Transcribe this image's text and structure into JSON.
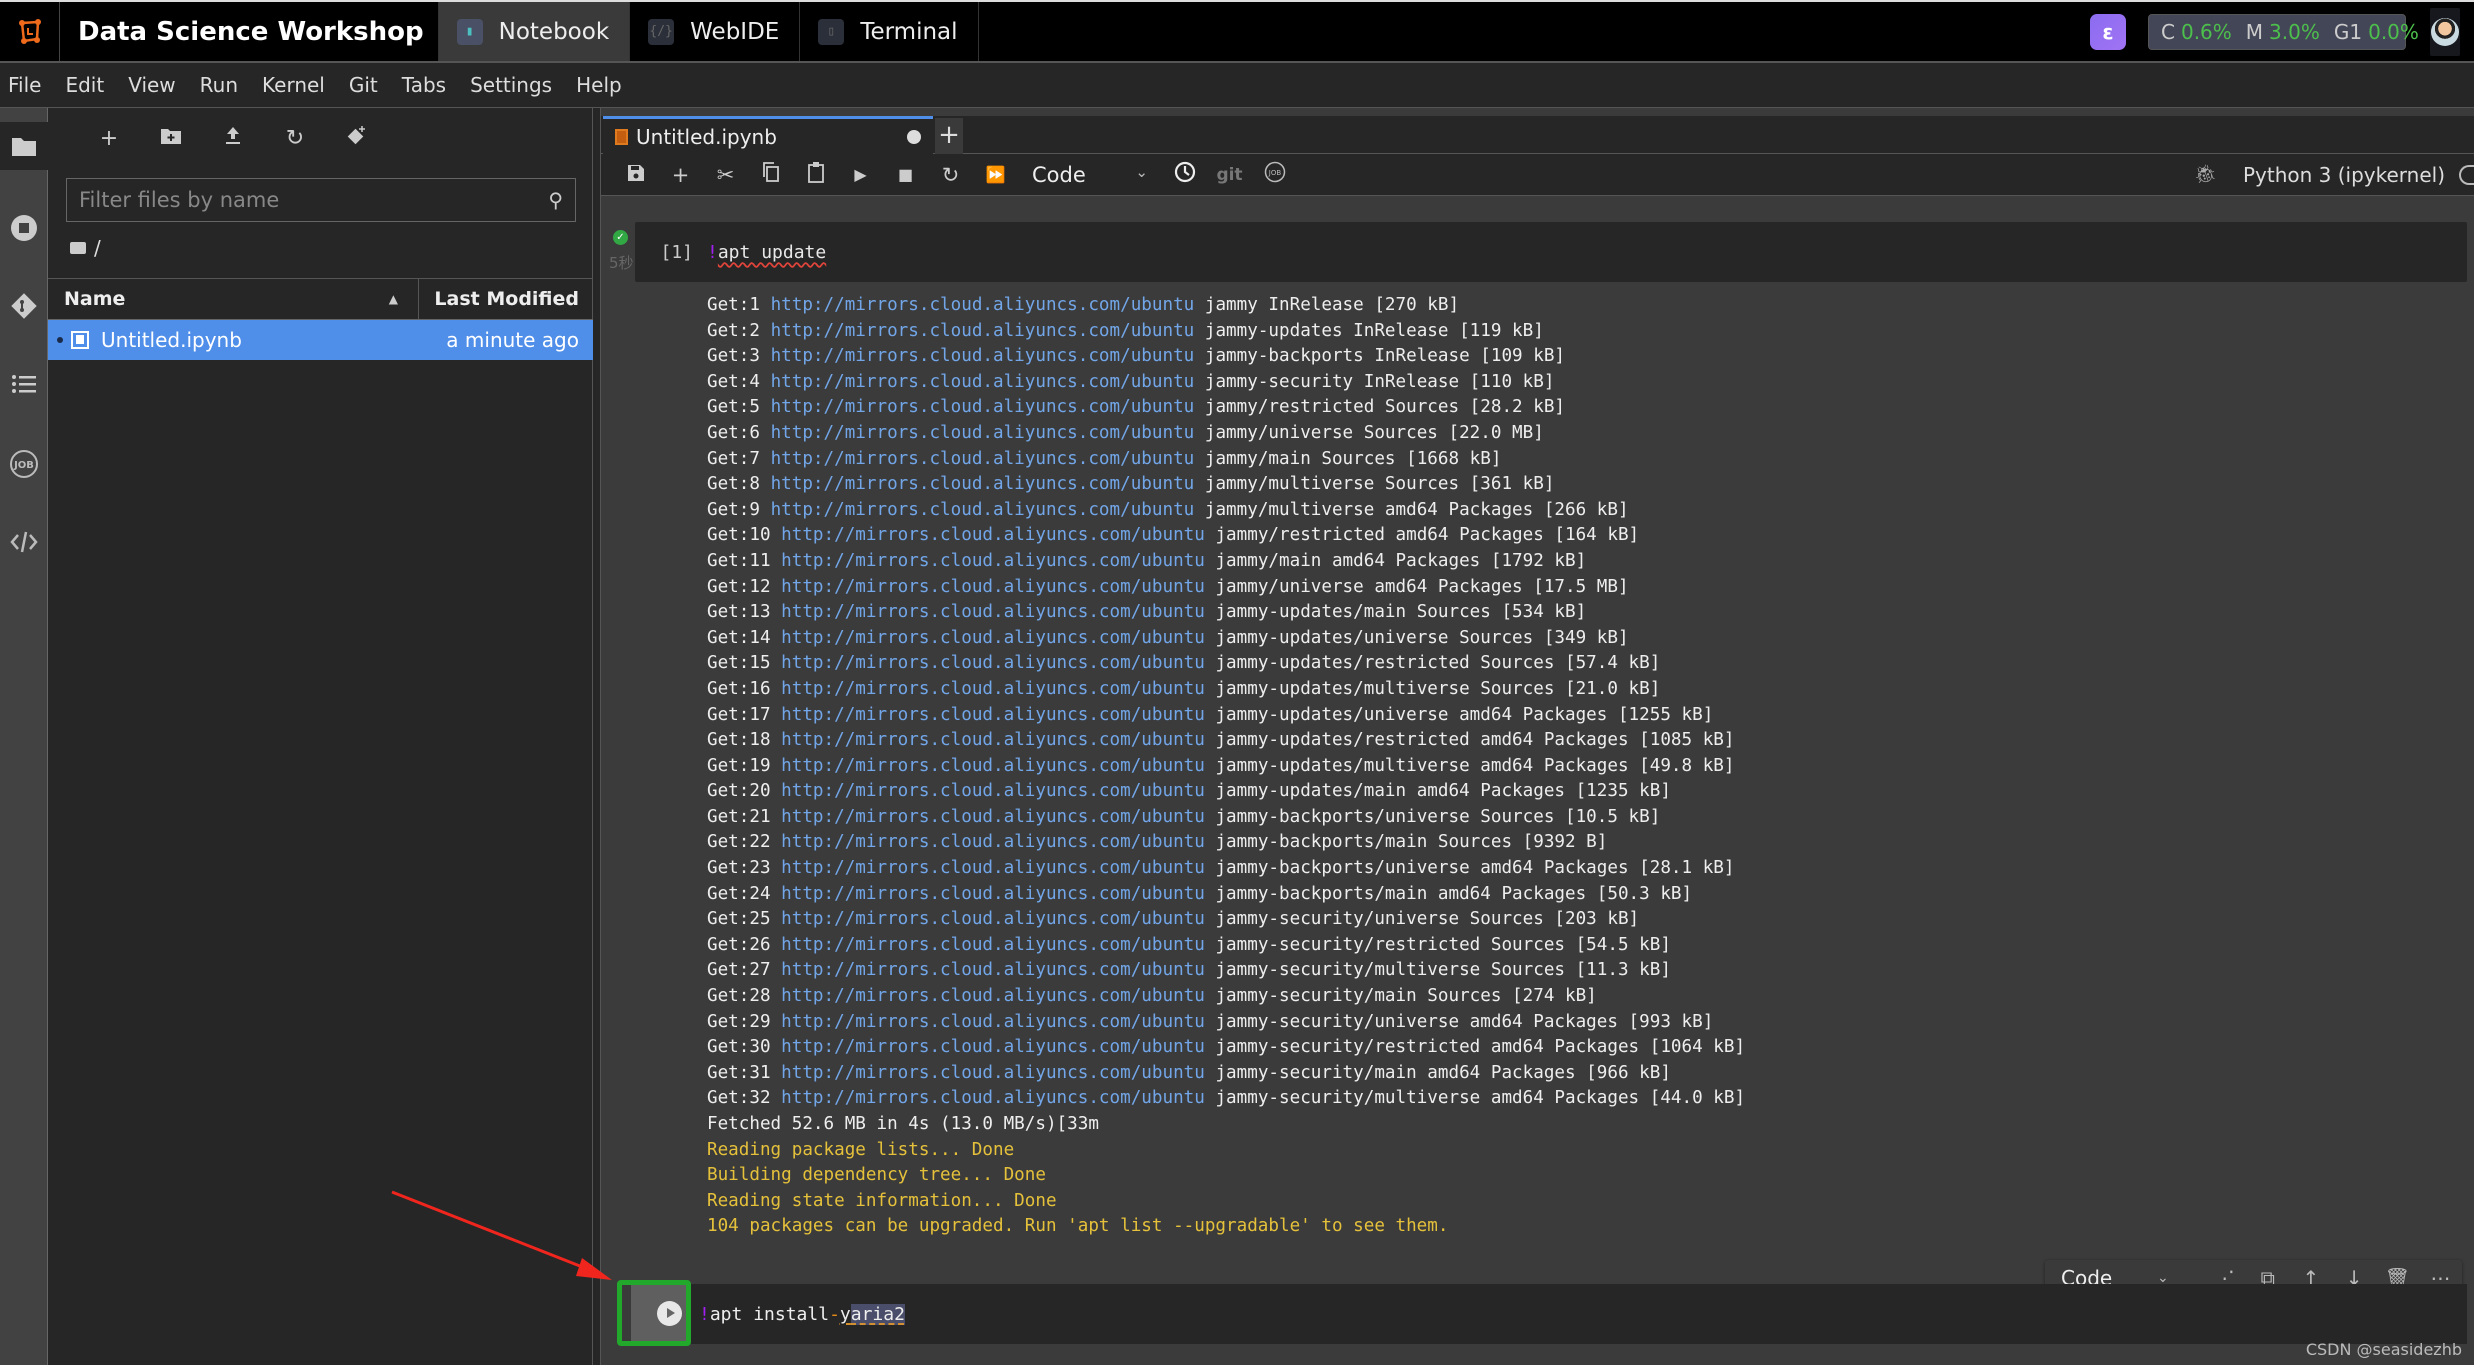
{
  "topbar": {
    "brand": "Data Science Workshop",
    "tabs": [
      {
        "label": "Notebook",
        "icon": "notebook-icon",
        "active": true
      },
      {
        "label": "WebIDE",
        "icon": "code-icon",
        "active": false
      },
      {
        "label": "Terminal",
        "icon": "terminal-icon",
        "active": false
      }
    ],
    "metrics": {
      "cpu_label": "C",
      "cpu": "0.6%",
      "mem_label": "M",
      "mem": "3.0%",
      "gpu_label": "G1",
      "gpu": "0.0%"
    }
  },
  "menu": [
    "File",
    "Edit",
    "View",
    "Run",
    "Kernel",
    "Git",
    "Tabs",
    "Settings",
    "Help"
  ],
  "filebrowser": {
    "search_placeholder": "Filter files by name",
    "breadcrumb": "/",
    "col_name": "Name",
    "col_modified": "Last Modified",
    "files": [
      {
        "name": "Untitled.ipynb",
        "modified": "a minute ago"
      }
    ]
  },
  "notebook": {
    "tab_title": "Untitled.ipynb",
    "cell_type": "Code",
    "git_label": "git",
    "kernel": "Python 3 (ipykernel)",
    "cell1": {
      "prompt": "[1]",
      "bang": "!",
      "code": " apt update",
      "duration": "5秒"
    },
    "output": {
      "url": "http://mirrors.cloud.aliyuncs.com/ubuntu",
      "gets": [
        [
          "Get:1",
          "jammy InRelease [270 kB]"
        ],
        [
          "Get:2",
          "jammy-updates InRelease [119 kB]"
        ],
        [
          "Get:3",
          "jammy-backports InRelease [109 kB]"
        ],
        [
          "Get:4",
          "jammy-security InRelease [110 kB]"
        ],
        [
          "Get:5",
          "jammy/restricted Sources [28.2 kB]"
        ],
        [
          "Get:6",
          "jammy/universe Sources [22.0 MB]"
        ],
        [
          "Get:7",
          "jammy/main Sources [1668 kB]"
        ],
        [
          "Get:8",
          "jammy/multiverse Sources [361 kB]"
        ],
        [
          "Get:9",
          "jammy/multiverse amd64 Packages [266 kB]"
        ],
        [
          "Get:10",
          "jammy/restricted amd64 Packages [164 kB]"
        ],
        [
          "Get:11",
          "jammy/main amd64 Packages [1792 kB]"
        ],
        [
          "Get:12",
          "jammy/universe amd64 Packages [17.5 MB]"
        ],
        [
          "Get:13",
          "jammy-updates/main Sources [534 kB]"
        ],
        [
          "Get:14",
          "jammy-updates/universe Sources [349 kB]"
        ],
        [
          "Get:15",
          "jammy-updates/restricted Sources [57.4 kB]"
        ],
        [
          "Get:16",
          "jammy-updates/multiverse Sources [21.0 kB]"
        ],
        [
          "Get:17",
          "jammy-updates/universe amd64 Packages [1255 kB]"
        ],
        [
          "Get:18",
          "jammy-updates/restricted amd64 Packages [1085 kB]"
        ],
        [
          "Get:19",
          "jammy-updates/multiverse amd64 Packages [49.8 kB]"
        ],
        [
          "Get:20",
          "jammy-updates/main amd64 Packages [1235 kB]"
        ],
        [
          "Get:21",
          "jammy-backports/universe Sources [10.5 kB]"
        ],
        [
          "Get:22",
          "jammy-backports/main Sources [9392 B]"
        ],
        [
          "Get:23",
          "jammy-backports/universe amd64 Packages [28.1 kB]"
        ],
        [
          "Get:24",
          "jammy-backports/main amd64 Packages [50.3 kB]"
        ],
        [
          "Get:25",
          "jammy-security/universe Sources [203 kB]"
        ],
        [
          "Get:26",
          "jammy-security/restricted Sources [54.5 kB]"
        ],
        [
          "Get:27",
          "jammy-security/multiverse Sources [11.3 kB]"
        ],
        [
          "Get:28",
          "jammy-security/main Sources [274 kB]"
        ],
        [
          "Get:29",
          "jammy-security/universe amd64 Packages [993 kB]"
        ],
        [
          "Get:30",
          "jammy-security/restricted amd64 Packages [1064 kB]"
        ],
        [
          "Get:31",
          "jammy-security/main amd64 Packages [966 kB]"
        ],
        [
          "Get:32",
          "jammy-security/multiverse amd64 Packages [44.0 kB]"
        ]
      ],
      "fetched": "Fetched 52.6 MB in 4s (13.0 MB/s)[33m",
      "warnings": [
        "Reading package lists... Done",
        "Building dependency tree... Done",
        "Reading state information... Done",
        "104 packages can be upgraded. Run 'apt list --upgradable' to see them."
      ]
    },
    "cell2": {
      "bang": "!",
      "code_a": " apt install ",
      "flag": "-",
      "code_b": "y",
      "code_c": " ",
      "code_d": "aria2"
    },
    "cell_toolbar_type": "Code"
  },
  "watermark": "CSDN @seasidezhb",
  "colors": {
    "accent": "#4f8ee9",
    "run_highlight": "#22a82a",
    "annotation_arrow": "#f0261e",
    "metric_ok": "#4cbf4c",
    "warning_text": "#e5c13b",
    "url_text": "#72a6e8"
  }
}
